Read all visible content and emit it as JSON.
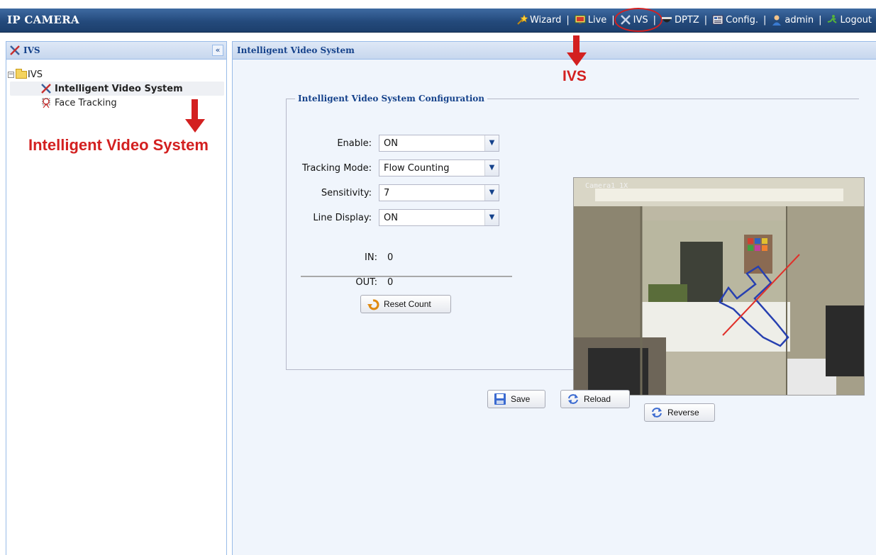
{
  "app": {
    "title": "IP CAMERA"
  },
  "topnav": {
    "wizard": "Wizard",
    "live": "Live",
    "ivs": "IVS",
    "dptz": "DPTZ",
    "config": "Config.",
    "user": "admin",
    "logout": "Logout",
    "separator": "|"
  },
  "sidebar": {
    "title": "IVS",
    "collapse_glyph": "«",
    "tree": {
      "root_label": "IVS",
      "expander": "−",
      "items": [
        {
          "label": "Intelligent Video System",
          "selected": true,
          "icon": "ivs-tools-icon"
        },
        {
          "label": "Face Tracking",
          "selected": false,
          "icon": "face-tracking-icon"
        }
      ]
    }
  },
  "annotations": {
    "top_label": "IVS",
    "side_label": "Intelligent Video System",
    "color": "#d32020"
  },
  "main": {
    "title": "Intelligent Video System",
    "fieldset_legend": "Intelligent Video System Configuration",
    "fields": [
      {
        "label": "Enable:",
        "value": "ON"
      },
      {
        "label": "Tracking Mode:",
        "value": "Flow Counting"
      },
      {
        "label": "Sensitivity:",
        "value": "7"
      },
      {
        "label": "Line Display:",
        "value": "ON"
      }
    ],
    "counts": {
      "in_label": "IN:",
      "in_value": "0",
      "out_label": "OUT:",
      "out_value": "0"
    },
    "reset_button": "Reset Count",
    "video_caption": "Camera1 1X",
    "reverse_button": "Reverse",
    "save_button": "Save",
    "reload_button": "Reload"
  },
  "colors": {
    "topbar": "#244a7c",
    "panel_border": "#99bbe8",
    "header_text": "#15428b",
    "flow_line": "#e0302a",
    "detect_zone": "#2740b0"
  }
}
